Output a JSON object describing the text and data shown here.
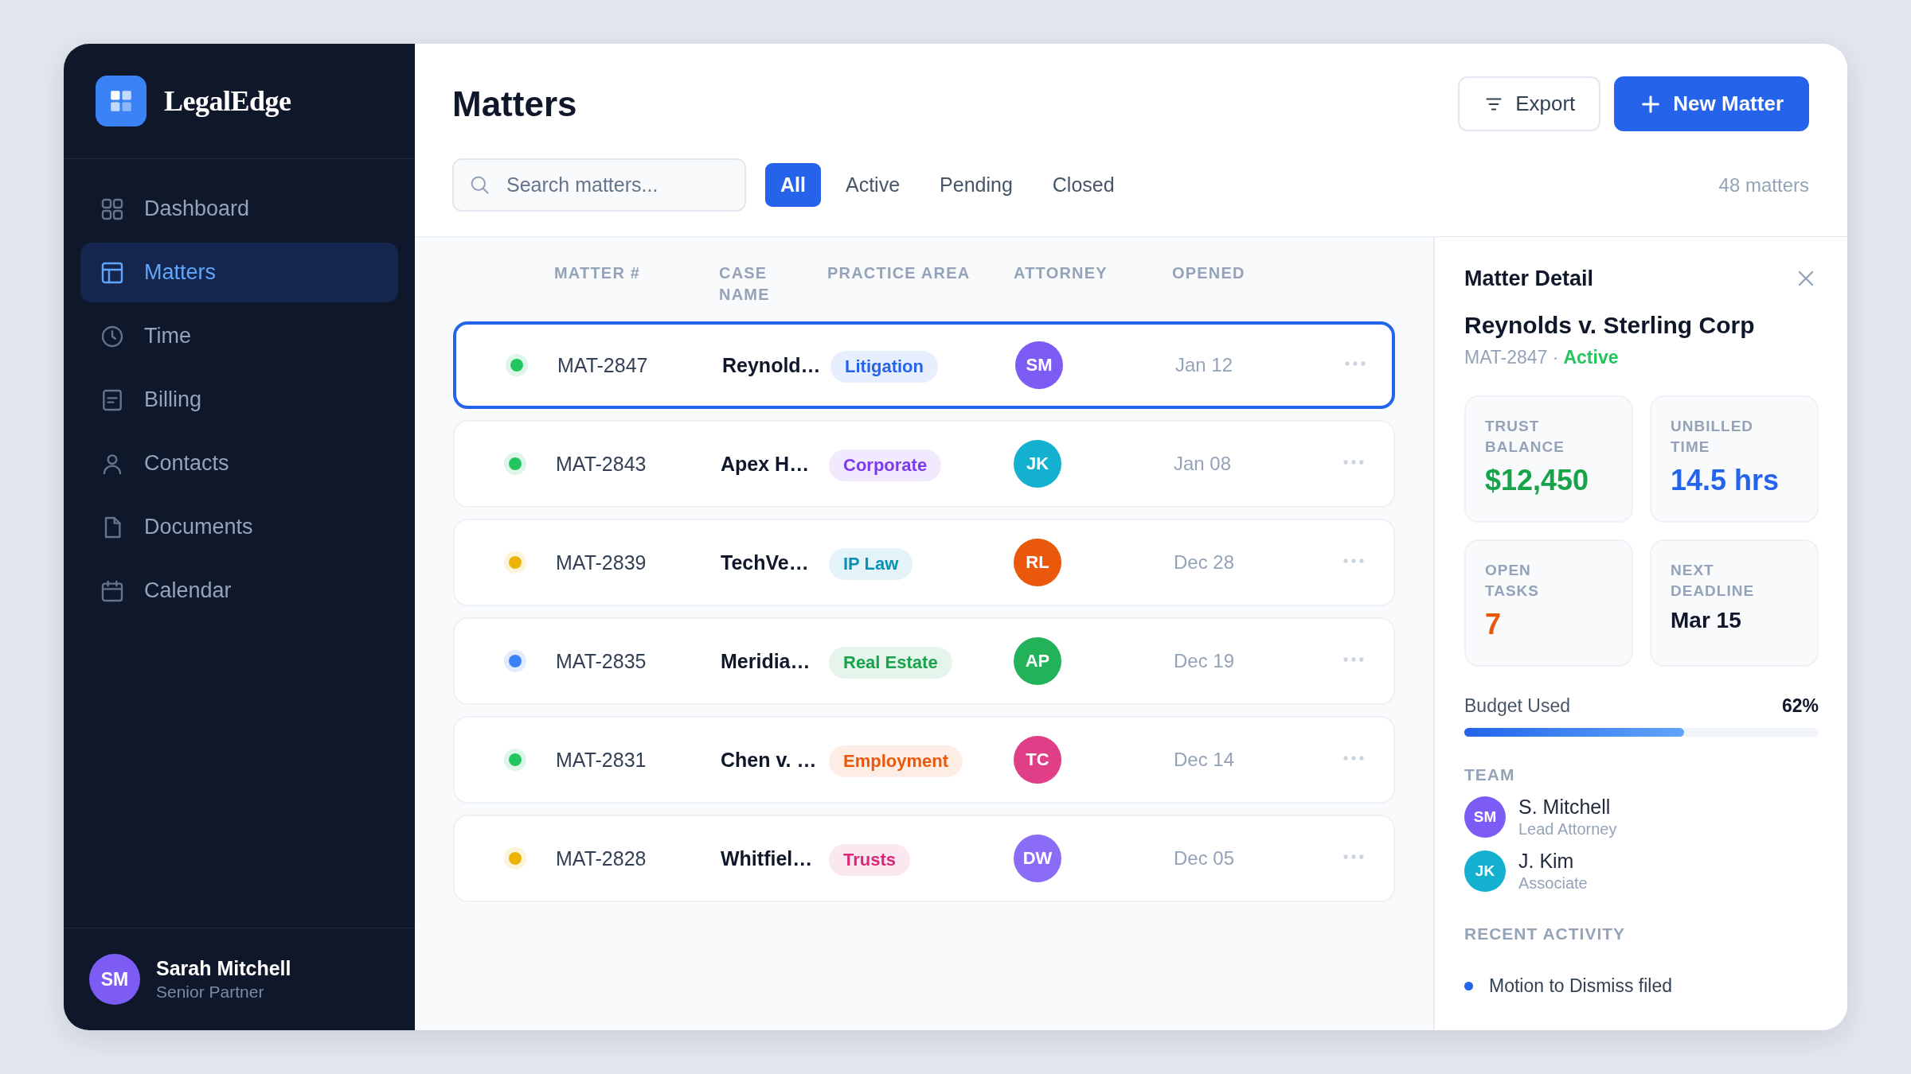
{
  "sidebar": {
    "brand": "LegalEdge",
    "items": [
      {
        "label": "Dashboard",
        "selected": false
      },
      {
        "label": "Matters",
        "selected": true
      },
      {
        "label": "Time",
        "selected": false
      },
      {
        "label": "Billing",
        "selected": false
      },
      {
        "label": "Contacts",
        "selected": false
      },
      {
        "label": "Documents",
        "selected": false
      },
      {
        "label": "Calendar",
        "selected": false
      }
    ],
    "user": {
      "initials": "SM",
      "name": "Sarah Mitchell",
      "role": "Senior Partner"
    }
  },
  "header": {
    "title": "Matters",
    "buttons": [
      {
        "label": "Export",
        "kind": "secondary"
      },
      {
        "label": "New Matter",
        "kind": "primary"
      }
    ]
  },
  "toolbar": {
    "search": {
      "placeholder": "Search matters..."
    },
    "filters": [
      {
        "label": "All",
        "selected": true
      },
      {
        "label": "Active",
        "selected": false
      },
      {
        "label": "Pending",
        "selected": false
      },
      {
        "label": "Closed",
        "selected": false
      }
    ],
    "count": "48 matters"
  },
  "table": {
    "columns": [
      "MATTER #",
      "CASE NAME",
      "PRACTICE AREA",
      "ATTORNEY",
      "OPENED"
    ],
    "rows": [
      {
        "selected": true,
        "status": {
          "color": "#22c55e"
        },
        "matter": "MAT-2847",
        "case_name": "Reynold…",
        "practice_area": {
          "label": "Litigation",
          "color": "#2563eb"
        },
        "attorney": {
          "initials": "SM",
          "color": "#7c5cf5"
        },
        "opened": "Jan 12"
      },
      {
        "selected": false,
        "status": {
          "color": "#22c55e"
        },
        "matter": "MAT-2843",
        "case_name": "Apex H…",
        "practice_area": {
          "label": "Corporate",
          "color": "#7c3aed"
        },
        "attorney": {
          "initials": "JK",
          "color": "#14b0d0"
        },
        "opened": "Jan 08"
      },
      {
        "selected": false,
        "status": {
          "color": "#eab308"
        },
        "matter": "MAT-2839",
        "case_name": "TechVe…",
        "practice_area": {
          "label": "IP Law",
          "color": "#0891b2"
        },
        "attorney": {
          "initials": "RL",
          "color": "#ea580c"
        },
        "opened": "Dec 28"
      },
      {
        "selected": false,
        "status": {
          "color": "#3b82f6"
        },
        "matter": "MAT-2835",
        "case_name": "Meridia…",
        "practice_area": {
          "label": "Real Estate",
          "color": "#16a34a"
        },
        "attorney": {
          "initials": "AP",
          "color": "#22b35a"
        },
        "opened": "Dec 19"
      },
      {
        "selected": false,
        "status": {
          "color": "#22c55e"
        },
        "matter": "MAT-2831",
        "case_name": "Chen v. …",
        "practice_area": {
          "label": "Employment",
          "color": "#ea580c"
        },
        "attorney": {
          "initials": "TC",
          "color": "#e03e86"
        },
        "opened": "Dec 14"
      },
      {
        "selected": false,
        "status": {
          "color": "#eab308"
        },
        "matter": "MAT-2828",
        "case_name": "Whitfiel…",
        "practice_area": {
          "label": "Trusts",
          "color": "#db2777"
        },
        "attorney": {
          "initials": "DW",
          "color": "#8b6cf6"
        },
        "opened": "Dec 05"
      }
    ]
  },
  "detail": {
    "title": "Matter Detail",
    "case_title": "Reynolds v. Sterling Corp",
    "reference": "MAT-2847 ·",
    "status": {
      "label": "Active",
      "color": "#22c55e"
    },
    "stats": [
      {
        "label": "TRUST BALANCE",
        "value": "$12,450",
        "color": "#16a34a"
      },
      {
        "label": "UNBILLED TIME",
        "value": "14.5 hrs",
        "color": "#2563eb"
      },
      {
        "label": "OPEN TASKS",
        "value": "7",
        "color": "#ea580c"
      },
      {
        "label": "NEXT DEADLINE",
        "value": "Mar 15",
        "color": "#0f172a"
      }
    ],
    "budget": {
      "label": "Budget Used",
      "reading": "62%",
      "level": 0.62
    },
    "team_heading": "TEAM",
    "team": [
      {
        "initials": "SM",
        "name": "S. Mitchell",
        "role": "Lead Attorney",
        "color": "#7c5cf5"
      },
      {
        "initials": "JK",
        "name": "J. Kim",
        "role": "Associate",
        "color": "#14b0d0"
      }
    ],
    "activity_heading": "RECENT ACTIVITY",
    "activity": [
      "Motion to Dismiss filed"
    ]
  }
}
